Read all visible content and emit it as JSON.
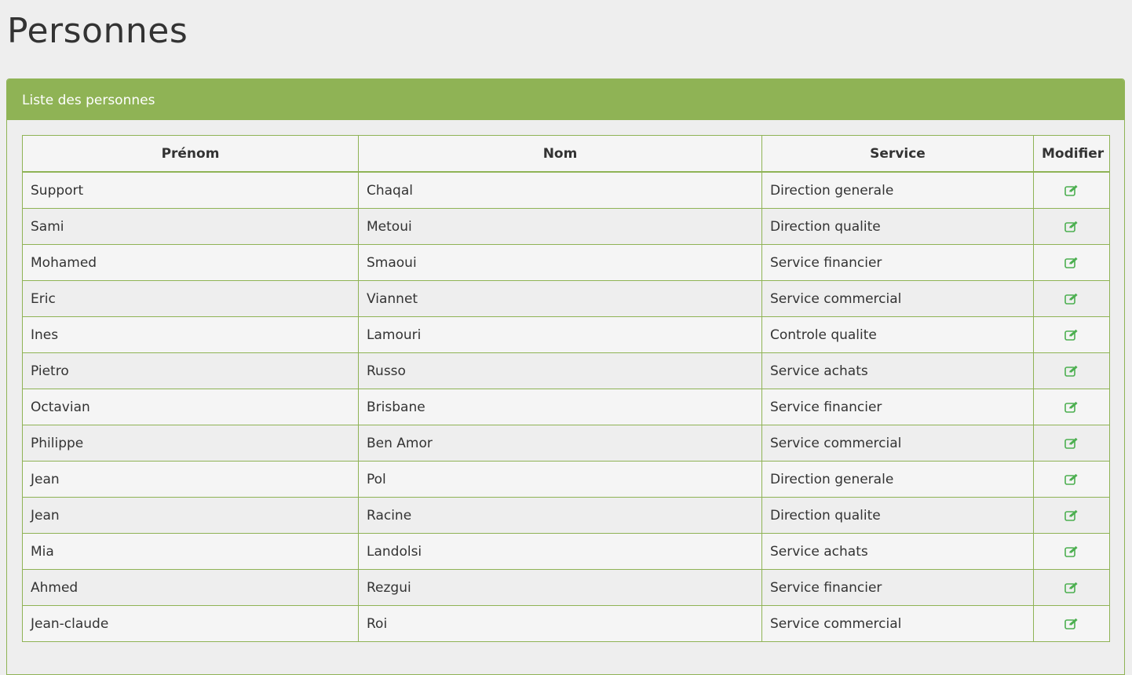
{
  "page": {
    "title": "Personnes"
  },
  "panel": {
    "heading": "Liste des personnes"
  },
  "table": {
    "headers": {
      "prenom": "Prénom",
      "nom": "Nom",
      "service": "Service",
      "modifier": "Modifier"
    },
    "rows": [
      {
        "prenom": "Support",
        "nom": "Chaqal",
        "service": "Direction generale"
      },
      {
        "prenom": "Sami",
        "nom": "Metoui",
        "service": "Direction qualite"
      },
      {
        "prenom": "Mohamed",
        "nom": "Smaoui",
        "service": "Service financier"
      },
      {
        "prenom": "Eric",
        "nom": "Viannet",
        "service": "Service commercial"
      },
      {
        "prenom": "Ines",
        "nom": "Lamouri",
        "service": "Controle qualite"
      },
      {
        "prenom": "Pietro",
        "nom": "Russo",
        "service": "Service achats"
      },
      {
        "prenom": "Octavian",
        "nom": "Brisbane",
        "service": "Service financier"
      },
      {
        "prenom": "Philippe",
        "nom": "Ben Amor",
        "service": "Service commercial"
      },
      {
        "prenom": "Jean",
        "nom": "Pol",
        "service": "Direction generale"
      },
      {
        "prenom": "Jean",
        "nom": "Racine",
        "service": "Direction qualite"
      },
      {
        "prenom": "Mia",
        "nom": "Landolsi",
        "service": "Service achats"
      },
      {
        "prenom": "Ahmed",
        "nom": "Rezgui",
        "service": "Service financier"
      },
      {
        "prenom": "Jean-claude",
        "nom": "Roi",
        "service": "Service commercial"
      }
    ]
  },
  "icons": {
    "edit": "edit-icon"
  },
  "colors": {
    "accent": "#8fb355",
    "icon": "#4caf50",
    "background": "#eeeeee"
  }
}
